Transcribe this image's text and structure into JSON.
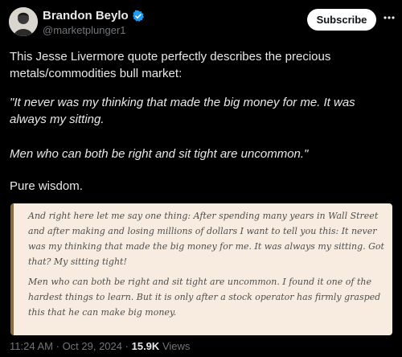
{
  "author": {
    "name": "Brandon Beylo",
    "handle": "@marketplunger1",
    "verified_color": "#1d9bf0"
  },
  "header": {
    "subscribe_label": "Subscribe",
    "more_icon": "ellipsis-icon"
  },
  "tweet": {
    "intro": "This Jesse Livermore quote perfectly describes the precious metals/commodities bull market:",
    "quote_line1": "\"It never was my thinking that made the big money for me. It was always my sitting.",
    "quote_line2": "Men who can both be right and sit tight are uncommon.\"",
    "closing": "Pure wisdom."
  },
  "quote_card": {
    "paragraph1": "And right here let me say one thing: After spending many years in Wall Street and after making and losing millions of dollars I want to tell you this: It never was my thinking that made the big money for me. It was always my sitting. Got that? My sitting tight!",
    "paragraph2": "Men who can both be right and sit tight are uncommon. I found it one of the hardest things to learn. But it is only after a stock operator has firmly grasped this that he can make big money.",
    "background": "#f7ecdf",
    "accent": "#8a6a43"
  },
  "meta": {
    "time": "11:24 AM",
    "separator": "·",
    "date": "Oct 29, 2024",
    "views_count": "15.9K",
    "views_label": "Views"
  }
}
